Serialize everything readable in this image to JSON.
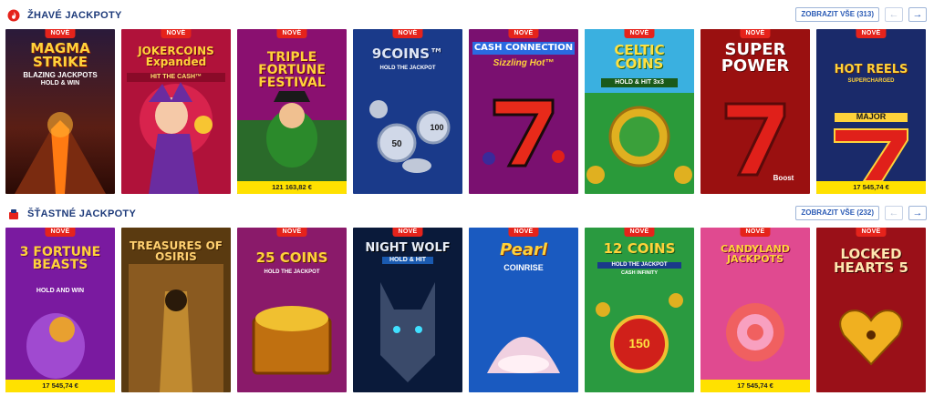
{
  "sections": [
    {
      "title": "ŽHAVÉ JACKPOTY",
      "show_all": "ZOBRAZIT VŠE (313)",
      "prev_icon": "arrow-left-icon",
      "next_icon": "arrow-right-icon",
      "games": [
        {
          "name": "MAGMA STRIKE",
          "sub": "BLAZING JACKPOTS",
          "sub2": "HOLD & WIN",
          "badge": "NOVÉ",
          "jackpot": ""
        },
        {
          "name": "JOKERCOINS Expanded",
          "sub": "HIT THE CASH™",
          "sub2": "",
          "badge": "NOVÉ",
          "jackpot": ""
        },
        {
          "name": "TRIPLE FORTUNE FESTIVAL",
          "sub": "",
          "sub2": "",
          "badge": "NOVÉ",
          "jackpot": "121 163,82 €"
        },
        {
          "name": "9COINS™",
          "sub": "HOLD THE JACKPOT",
          "sub2": "",
          "badge": "NOVÉ",
          "jackpot": "",
          "v1": "50",
          "v2": "100"
        },
        {
          "name": "CASH CONNECTION",
          "sub": "Sizzling Hot™",
          "sub2": "",
          "badge": "NOVÉ",
          "jackpot": ""
        },
        {
          "name": "CELTIC COINS",
          "sub": "HOLD & HIT 3x3",
          "sub2": "",
          "badge": "NOVÉ",
          "jackpot": ""
        },
        {
          "name": "SUPER POWER",
          "sub": "Boost",
          "sub2": "",
          "badge": "NOVÉ",
          "jackpot": ""
        },
        {
          "name": "HOT REELS",
          "sub": "SUPERCHARGED",
          "sub2": "MAJOR",
          "badge": "NOVÉ",
          "jackpot": "17 545,74 €"
        }
      ]
    },
    {
      "title": "ŠŤASTNÉ JACKPOTY",
      "show_all": "ZOBRAZIT VŠE (232)",
      "prev_icon": "arrow-left-icon",
      "next_icon": "arrow-right-icon",
      "games": [
        {
          "name": "3 FORTUNE BEASTS",
          "sub": "HOLD AND WIN",
          "sub2": "",
          "badge": "NOVÉ",
          "jackpot": "17 545,74 €"
        },
        {
          "name": "TREASURES OF OSIRIS",
          "sub": "",
          "sub2": "",
          "badge": "",
          "jackpot": ""
        },
        {
          "name": "25 COINS",
          "sub": "HOLD THE JACKPOT",
          "sub2": "",
          "badge": "NOVÉ",
          "jackpot": ""
        },
        {
          "name": "NIGHT WOLF",
          "sub": "HOLD & HIT",
          "sub2": "",
          "badge": "NOVÉ",
          "jackpot": ""
        },
        {
          "name": "Pearl",
          "sub": "COINRISE",
          "sub2": "",
          "badge": "NOVÉ",
          "jackpot": ""
        },
        {
          "name": "12 COINS",
          "sub": "HOLD THE JACKPOT",
          "sub2": "CASH INFINITY",
          "badge": "NOVÉ",
          "jackpot": "",
          "v1": "150"
        },
        {
          "name": "CANDYLAND JACKPOTS",
          "sub": "",
          "sub2": "",
          "badge": "NOVÉ",
          "jackpot": "17 545,74 €"
        },
        {
          "name": "LOCKED HEARTS 5",
          "sub": "",
          "sub2": "",
          "badge": "NOVÉ",
          "jackpot": ""
        }
      ]
    }
  ],
  "colors": {
    "accent": "#e5231b",
    "heading": "#1d3a7a",
    "jackpot_bar": "#ffe100",
    "link": "#2a5ab5"
  }
}
